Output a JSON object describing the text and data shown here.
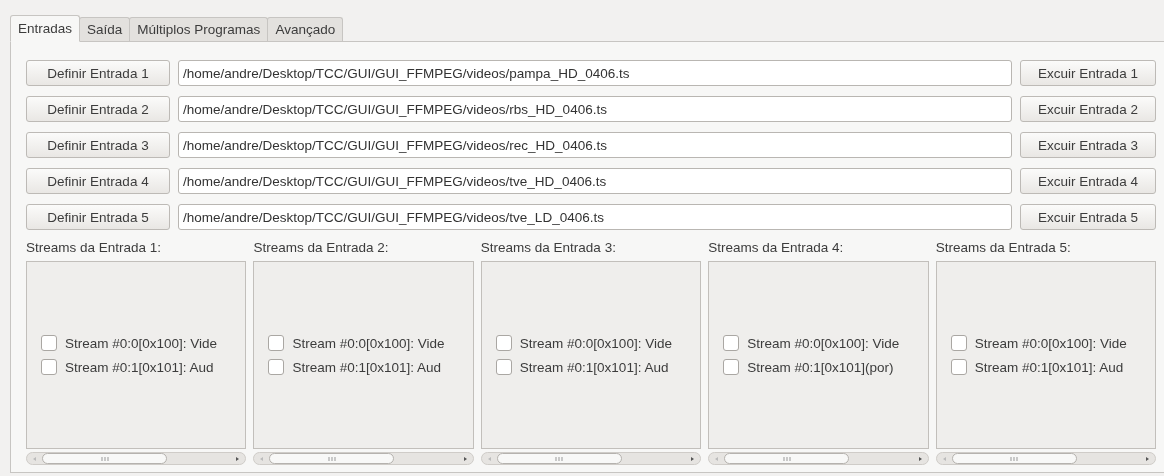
{
  "tabs": [
    {
      "label": "Entradas",
      "selected": true
    },
    {
      "label": "Saída",
      "selected": false
    },
    {
      "label": "Múltiplos Programas",
      "selected": false
    },
    {
      "label": "Avançado",
      "selected": false
    }
  ],
  "inputs": [
    {
      "define_button": "Definir Entrada 1",
      "path": "/home/andre/Desktop/TCC/GUI/GUI_FFMPEG/videos/pampa_HD_0406.ts",
      "remove_button": "Excuir Entrada 1"
    },
    {
      "define_button": "Definir Entrada 2",
      "path": "/home/andre/Desktop/TCC/GUI/GUI_FFMPEG/videos/rbs_HD_0406.ts",
      "remove_button": "Excuir Entrada 2"
    },
    {
      "define_button": "Definir Entrada 3",
      "path": "/home/andre/Desktop/TCC/GUI/GUI_FFMPEG/videos/rec_HD_0406.ts",
      "remove_button": "Excuir Entrada 3"
    },
    {
      "define_button": "Definir Entrada 4",
      "path": "/home/andre/Desktop/TCC/GUI/GUI_FFMPEG/videos/tve_HD_0406.ts",
      "remove_button": "Excuir Entrada 4"
    },
    {
      "define_button": "Definir Entrada 5",
      "path": "/home/andre/Desktop/TCC/GUI/GUI_FFMPEG/videos/tve_LD_0406.ts",
      "remove_button": "Excuir Entrada 5"
    }
  ],
  "stream_panels": [
    {
      "label": "Streams da Entrada 1:",
      "streams": [
        {
          "label": "Stream #0:0[0x100]: Vide",
          "checked": false
        },
        {
          "label": "Stream #0:1[0x101]: Aud",
          "checked": false
        }
      ]
    },
    {
      "label": "Streams da Entrada 2:",
      "streams": [
        {
          "label": "Stream #0:0[0x100]: Vide",
          "checked": false
        },
        {
          "label": "Stream #0:1[0x101]: Aud",
          "checked": false
        }
      ]
    },
    {
      "label": "Streams da Entrada 3:",
      "streams": [
        {
          "label": "Stream #0:0[0x100]: Vide",
          "checked": false
        },
        {
          "label": "Stream #0:1[0x101]: Aud",
          "checked": false
        }
      ]
    },
    {
      "label": "Streams da Entrada 4:",
      "streams": [
        {
          "label": "Stream #0:0[0x100]: Vide",
          "checked": false
        },
        {
          "label": "Stream #0:1[0x101](por)",
          "checked": false
        }
      ]
    },
    {
      "label": "Streams da Entrada 5:",
      "streams": [
        {
          "label": "Stream #0:0[0x100]: Vide",
          "checked": false
        },
        {
          "label": "Stream #0:1[0x101]: Aud",
          "checked": false
        }
      ]
    }
  ]
}
